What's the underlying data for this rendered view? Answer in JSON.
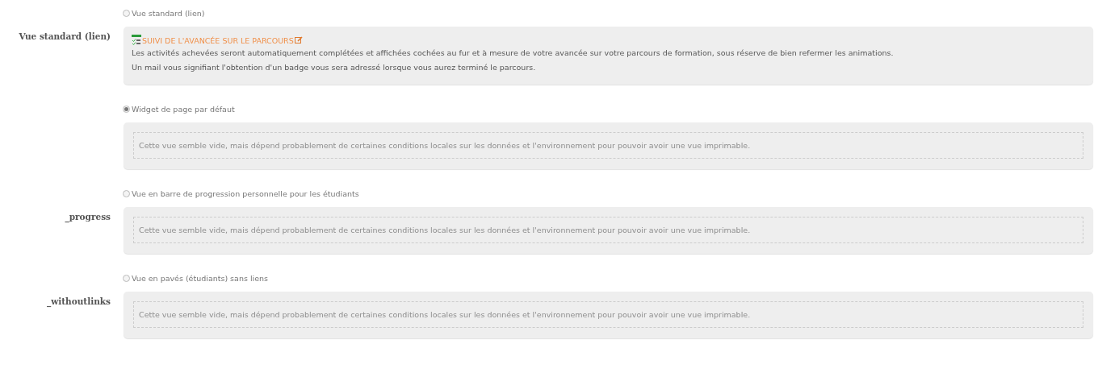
{
  "views": [
    {
      "option": "Vue standard (lien)",
      "selected": false,
      "label": "Vue standard (lien)",
      "kind": "content",
      "title": "SUIVI DE L'AVANCÉE SUR LE PARCOURS",
      "lines": [
        "Les activités achevées seront automatiquement complétées et affichées cochées au fur et à mesure de votre avancée sur votre parcours de formation, sous réserve de bien refermer les animations.",
        "Un mail vous signifiant l'obtention d'un badge vous sera adressé lorsque vous aurez terminé le parcours."
      ]
    },
    {
      "option": "Widget de page par défaut",
      "selected": true,
      "kind": "empty",
      "message": "Cette vue semble vide, mais dépend probablement de certaines conditions locales sur les données et l'environnement pour pouvoir avoir une vue imprimable."
    },
    {
      "option": "Vue en barre de progression personnelle pour les étudiants",
      "selected": false,
      "label": "_progress",
      "kind": "empty",
      "message": "Cette vue semble vide, mais dépend probablement de certaines conditions locales sur les données et l'environnement pour pouvoir avoir une vue imprimable."
    },
    {
      "option": "Vue en pavés (étudiants) sans liens",
      "selected": false,
      "label": "_withoutlinks",
      "kind": "empty",
      "message": "Cette vue semble vide, mais dépend probablement de certaines conditions locales sur les données et l'environnement pour pouvoir avoir une vue imprimable."
    }
  ]
}
